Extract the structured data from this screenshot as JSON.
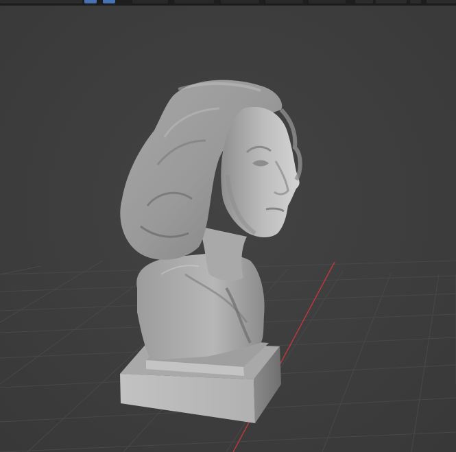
{
  "app": {
    "name": "3D viewport",
    "accent_color": "#4772b3",
    "background_color": "#3d3d3d"
  },
  "viewport": {
    "object": "bust-sculpture",
    "shading": "solid",
    "grid_visible": true,
    "x_axis_color": "#c0383f"
  },
  "header": {
    "buttons": [
      {
        "name": "header-field-left"
      },
      {
        "name": "header-toggle-blue-1"
      },
      {
        "name": "header-toggle-blue-2"
      },
      {
        "name": "header-menu-1"
      },
      {
        "name": "header-menu-2"
      },
      {
        "name": "header-menu-3"
      },
      {
        "name": "header-menu-4"
      },
      {
        "name": "header-menu-5"
      },
      {
        "name": "header-overlay-1"
      },
      {
        "name": "header-overlay-2"
      },
      {
        "name": "header-shading-1"
      },
      {
        "name": "header-shading-2"
      }
    ]
  }
}
